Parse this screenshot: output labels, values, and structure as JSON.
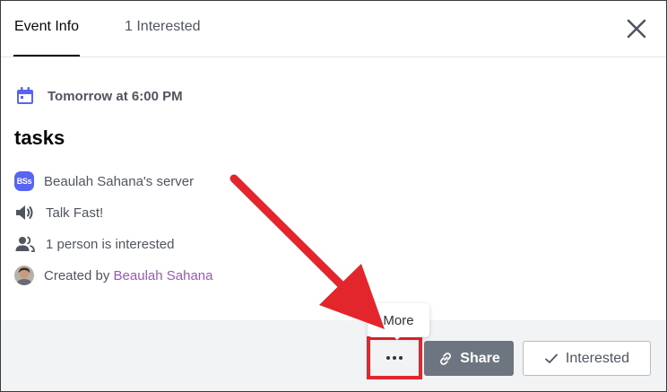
{
  "tabs": [
    {
      "label": "Event Info",
      "active": true
    },
    {
      "label": "1 Interested",
      "active": false
    }
  ],
  "event": {
    "datetime": "Tomorrow at 6:00 PM",
    "title": "tasks",
    "server_badge": "BSs",
    "server_name": "Beaulah Sahana's server",
    "channel": "Talk Fast!",
    "interested_count_text": "1 person is interested",
    "created_by_prefix": "Created by",
    "creator_name": "Beaulah Sahana"
  },
  "footer": {
    "more_tooltip": "More",
    "share_label": "Share",
    "interested_label": "Interested"
  },
  "colors": {
    "calendar_icon": "#5865f2",
    "server_badge_bg": "#5865f2",
    "creator_link": "#9b59b6",
    "annotation_red": "#e3262c",
    "share_button_bg": "#6d7580",
    "footer_bg": "#f2f3f5"
  },
  "icons": {
    "close": "close-icon",
    "calendar": "calendar-icon",
    "speaker": "speaker-icon",
    "people": "people-icon",
    "more": "more-dots-icon",
    "share": "link-icon",
    "check": "checkmark-icon"
  }
}
